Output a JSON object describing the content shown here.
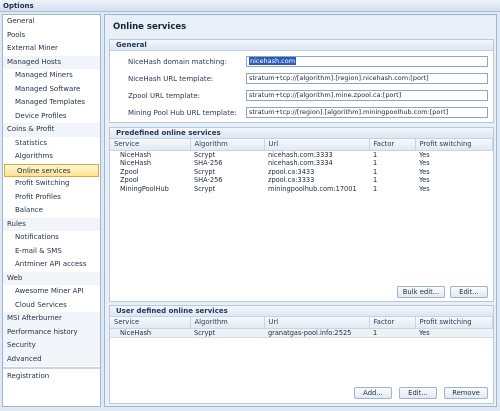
{
  "window": {
    "title": "Options"
  },
  "sidebar": {
    "items": [
      {
        "label": "General",
        "level": 0,
        "group": false
      },
      {
        "label": "Pools",
        "level": 0,
        "group": false
      },
      {
        "label": "External Miner",
        "level": 0,
        "group": false
      },
      {
        "label": "Managed Hosts",
        "level": 0,
        "group": true
      },
      {
        "label": "Managed Miners",
        "level": 1
      },
      {
        "label": "Managed Software",
        "level": 1
      },
      {
        "label": "Managed Templates",
        "level": 1
      },
      {
        "label": "Device Profiles",
        "level": 1
      },
      {
        "label": "Coins & Profit",
        "level": 0,
        "group": true
      },
      {
        "label": "Statistics",
        "level": 1
      },
      {
        "label": "Algorithms",
        "level": 1
      },
      {
        "label": "Online services",
        "level": 1,
        "selected": true
      },
      {
        "label": "Profit Switching",
        "level": 1
      },
      {
        "label": "Profit Profiles",
        "level": 1
      },
      {
        "label": "Balance",
        "level": 1
      },
      {
        "label": "Rules",
        "level": 0,
        "group": true
      },
      {
        "label": "Notifications",
        "level": 1
      },
      {
        "label": "E-mail & SMS",
        "level": 1
      },
      {
        "label": "Antminer API access",
        "level": 1
      },
      {
        "label": "Web",
        "level": 0,
        "group": true
      },
      {
        "label": "Awesome Miner API",
        "level": 1
      },
      {
        "label": "Cloud Services",
        "level": 1
      },
      {
        "label": "MSI Afterburner",
        "level": 0,
        "group": true
      },
      {
        "label": "Performance history",
        "level": 0,
        "group": true
      },
      {
        "label": "Security",
        "level": 0,
        "group": true
      },
      {
        "label": "Advanced",
        "level": 0,
        "group": true
      },
      {
        "label": "Registration",
        "level": 0,
        "group": false,
        "separator_before": true
      }
    ]
  },
  "main": {
    "title": "Online services",
    "general": {
      "header": "General",
      "fields": [
        {
          "label": "NiceHash domain matching:",
          "value": "nicehash.com",
          "selected": true
        },
        {
          "label": "NiceHash URL template:",
          "value": "stratum+tcp://[algorithm].[region].nicehash.com:[port]"
        },
        {
          "label": "Zpool URL template:",
          "value": "stratum+tcp://[algorithm].mine.zpool.ca:[port]"
        },
        {
          "label": "Mining Pool Hub URL template:",
          "value": "stratum+tcp://[region].[algorithm].miningpoolhub.com:[port]"
        }
      ]
    },
    "predefined": {
      "header": "Predefined online services",
      "columns": [
        "Service",
        "Algorithm",
        "Url",
        "Factor",
        "Profit switching"
      ],
      "rows": [
        [
          "NiceHash",
          "Scrypt",
          "nicehash.com:3333",
          "1",
          "Yes"
        ],
        [
          "NiceHash",
          "SHA-256",
          "nicehash.com:3334",
          "1",
          "Yes"
        ],
        [
          "Zpool",
          "Scrypt",
          "zpool.ca:3433",
          "1",
          "Yes"
        ],
        [
          "Zpool",
          "SHA-256",
          "zpool.ca:3333",
          "1",
          "Yes"
        ],
        [
          "MiningPoolHub",
          "Scrypt",
          "miningpoolhub.com:17001",
          "1",
          "Yes"
        ]
      ],
      "buttons": {
        "bulk_edit": "Bulk edit...",
        "edit": "Edit..."
      }
    },
    "user_defined": {
      "header": "User defined online services",
      "columns": [
        "Service",
        "Algorithm",
        "Url",
        "Factor",
        "Profit switching"
      ],
      "rows": [
        [
          "NiceHash",
          "Scrypt",
          "granatgas-pool.info:2525",
          "1",
          "Yes"
        ]
      ],
      "buttons": {
        "add": "Add...",
        "edit": "Edit...",
        "remove": "Remove"
      }
    }
  },
  "colors": {
    "accent_selected": "#ffe28e",
    "header_bg": "#dde7f2",
    "input_selection": "#2b5cb8"
  }
}
